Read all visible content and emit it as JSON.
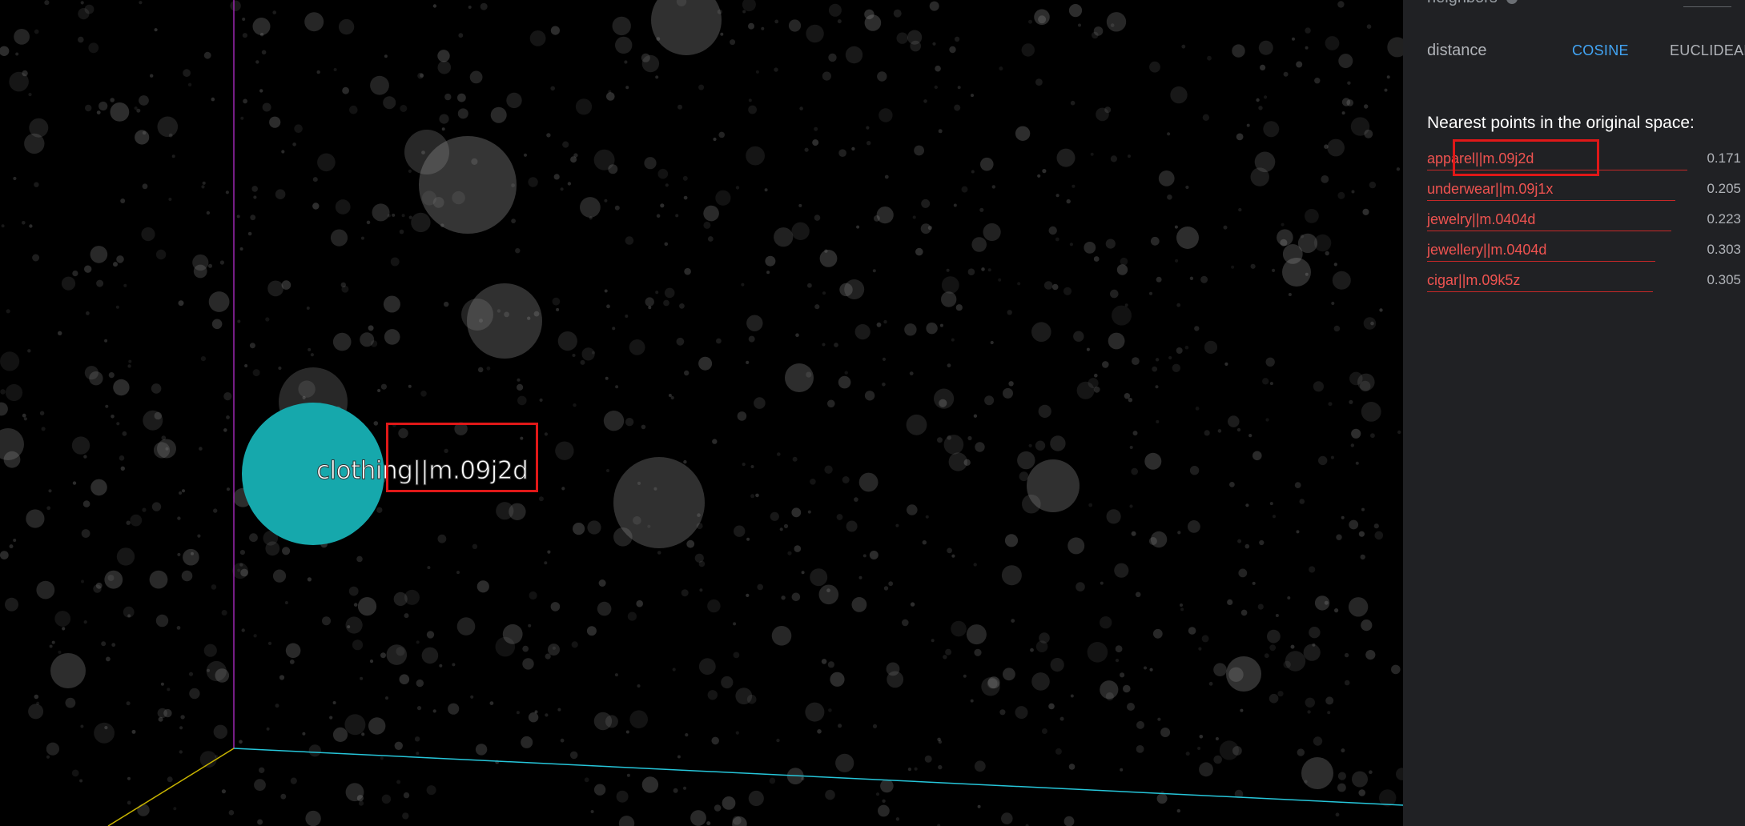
{
  "projector": {
    "selected_point_label": "clothing||m.09j2d",
    "selected_point_color": "#16a8ac",
    "axis_colors": {
      "y": "#9c27b0",
      "x": "#26c6da",
      "z": "#c8b400"
    }
  },
  "panel": {
    "neighbors_label": "neighbors",
    "distance_label": "distance",
    "distance_options": [
      "COSINE",
      "EUCLIDEAN"
    ],
    "distance_selected": "COSINE",
    "nearest_title": "Nearest points in the original space:",
    "nearest_points": [
      {
        "name": "apparel||m.09j2d",
        "distance": "0.171"
      },
      {
        "name": "underwear||m.09j1x",
        "distance": "0.205"
      },
      {
        "name": "jewelry||m.0404d",
        "distance": "0.223"
      },
      {
        "name": "jewellery||m.0404d",
        "distance": "0.303"
      },
      {
        "name": "cigar||m.09k5z",
        "distance": "0.305"
      }
    ]
  }
}
